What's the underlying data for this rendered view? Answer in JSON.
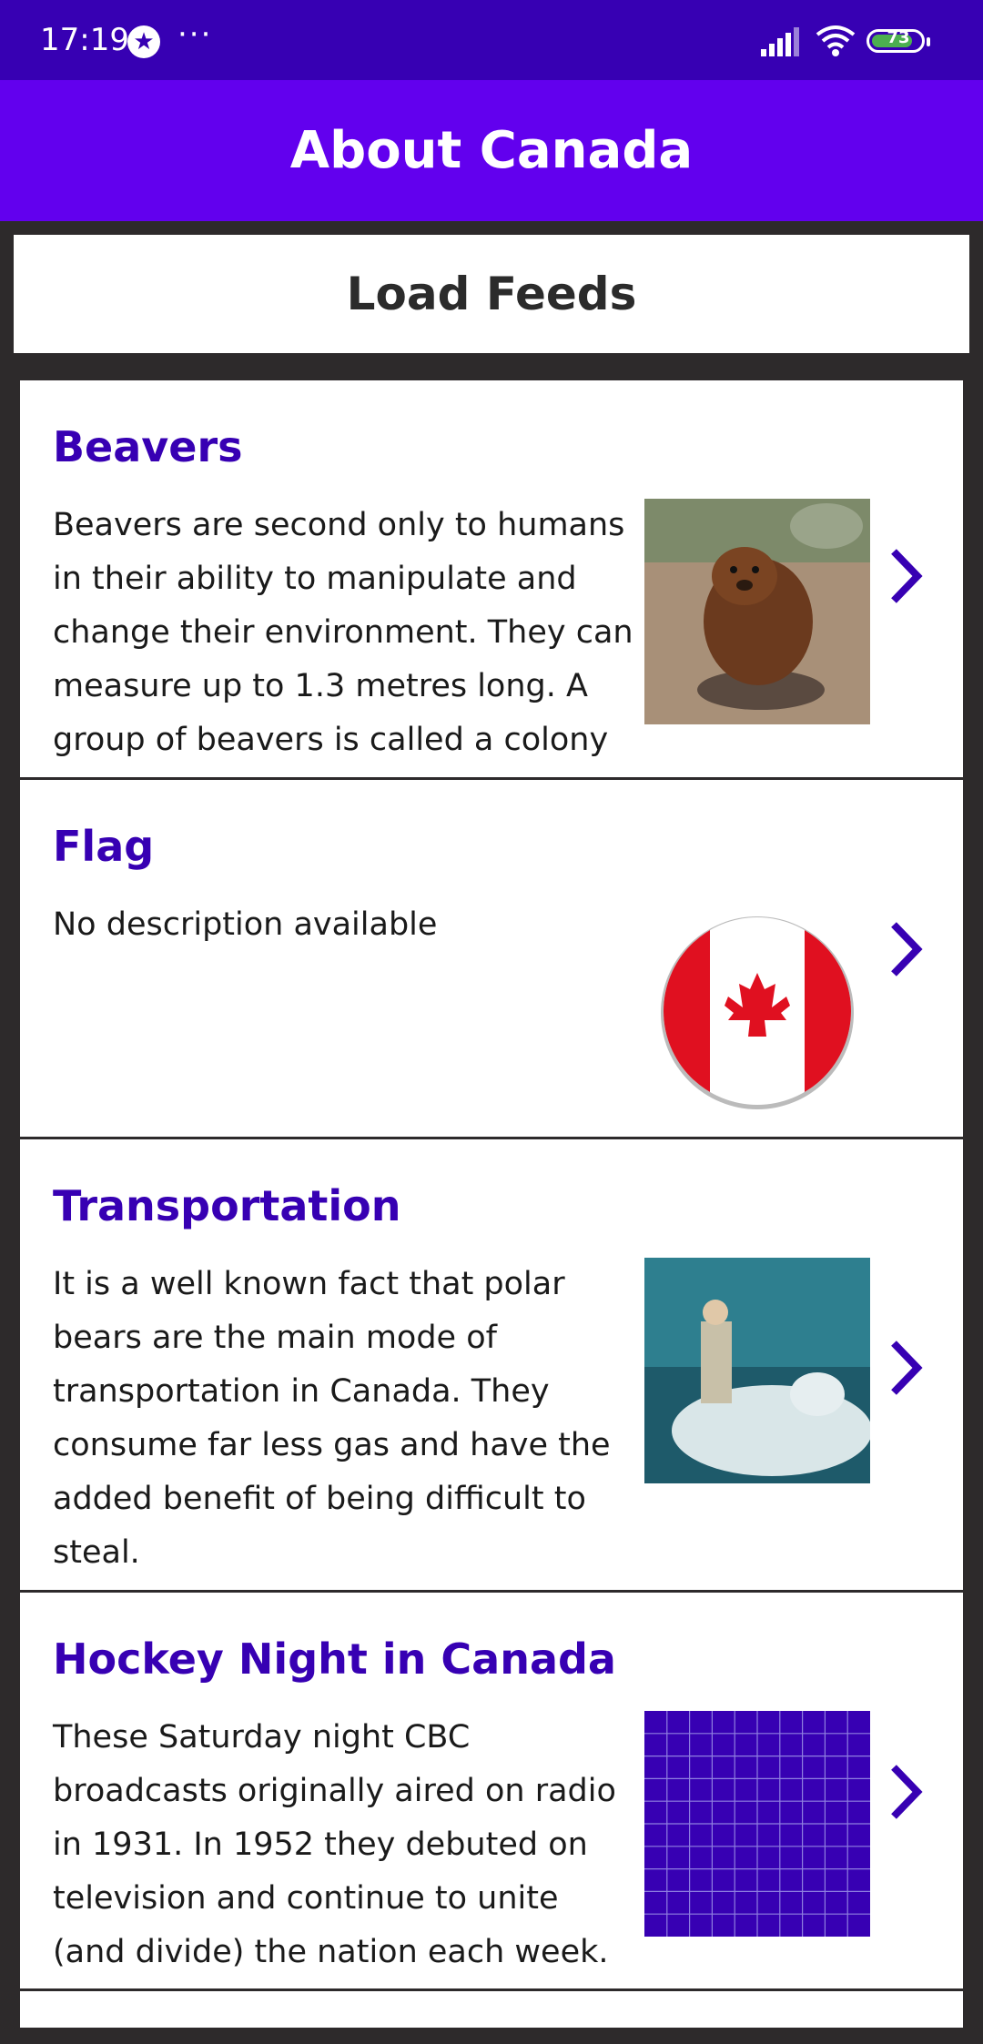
{
  "status_bar": {
    "time": "17:19",
    "star_icon": "★",
    "dots": "···",
    "battery": "73"
  },
  "app_bar": {
    "title": "About Canada"
  },
  "load_button": {
    "label": "Load Feeds"
  },
  "feeds": [
    {
      "title": "Beavers",
      "description": "Beavers are second only to humans in their ability to manipulate and change their environment. They can measure up to 1.3 metres long. A group of beavers is called a colony",
      "image": "beaver-photo"
    },
    {
      "title": "Flag",
      "description": "No description available",
      "image": "canadian-flag-button"
    },
    {
      "title": "Transportation",
      "description": "It is a well known fact that polar bears are the main mode of transportation in Canada. They consume far less gas and have the added benefit of being difficult to steal.",
      "image": "polar-bear-photo"
    },
    {
      "title": "Hockey Night in Canada",
      "description": "These Saturday night CBC broadcasts originally aired on radio in 1931. In 1952 they debuted on television and continue to unite (and divide) the nation each week.",
      "image": "placeholder-grid"
    }
  ],
  "colors": {
    "status_bar": "#3700b3",
    "app_bar": "#6200ee",
    "title": "#3700b3",
    "background": "#2d2a2b"
  }
}
